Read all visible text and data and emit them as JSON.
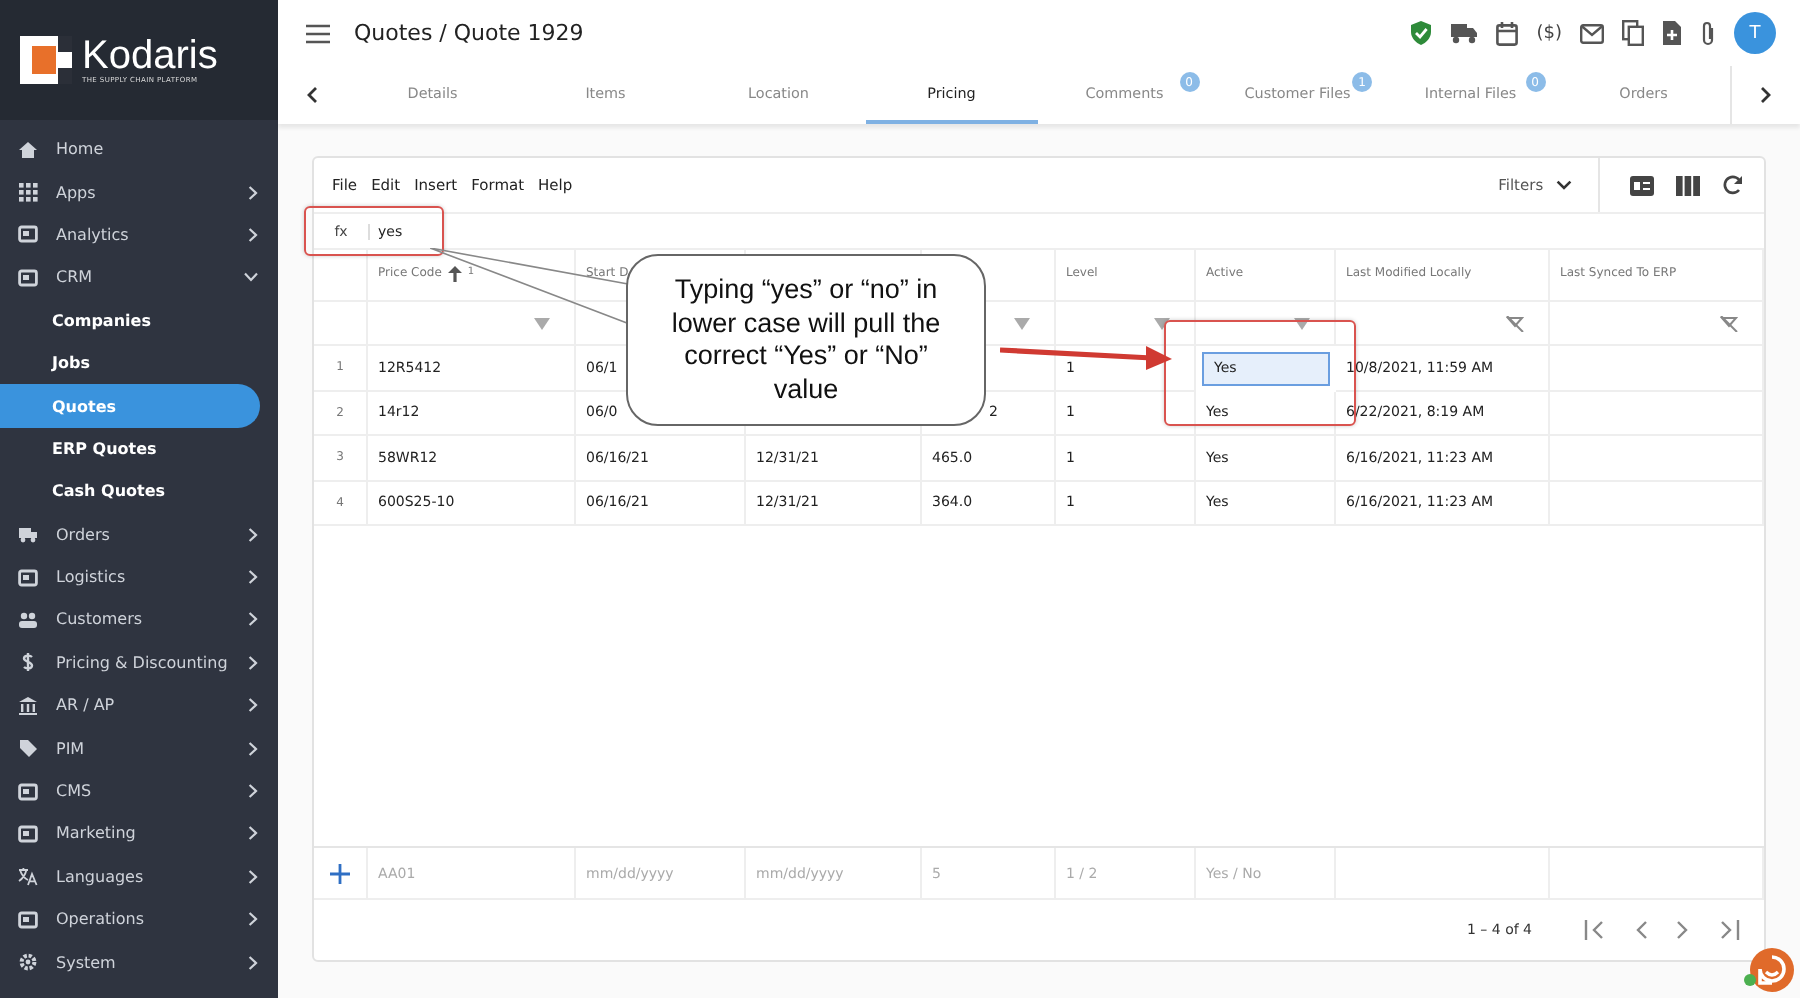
{
  "logo": {
    "name": "Kodaris",
    "tagline": "THE SUPPLY CHAIN PLATFORM"
  },
  "sidebar": {
    "items": [
      {
        "label": "Home",
        "selected": false
      },
      {
        "label": "Apps",
        "selected": false,
        "expanded": false
      },
      {
        "label": "Analytics",
        "selected": false,
        "expanded": false
      },
      {
        "label": "CRM",
        "selected": false,
        "expanded": true,
        "children": [
          {
            "label": "Companies",
            "selected": false
          },
          {
            "label": "Jobs",
            "selected": false
          },
          {
            "label": "Quotes",
            "selected": true
          },
          {
            "label": "ERP Quotes",
            "selected": false
          },
          {
            "label": "Cash Quotes",
            "selected": false
          }
        ]
      },
      {
        "label": "Orders",
        "selected": false,
        "expanded": false
      },
      {
        "label": "Logistics",
        "selected": false,
        "expanded": false
      },
      {
        "label": "Customers",
        "selected": false,
        "expanded": false
      },
      {
        "label": "Pricing & Discounting",
        "selected": false,
        "expanded": false
      },
      {
        "label": "AR / AP",
        "selected": false,
        "expanded": false
      },
      {
        "label": "PIM",
        "selected": false,
        "expanded": false
      },
      {
        "label": "CMS",
        "selected": false,
        "expanded": false
      },
      {
        "label": "Marketing",
        "selected": false,
        "expanded": false
      },
      {
        "label": "Languages",
        "selected": false,
        "expanded": false
      },
      {
        "label": "Operations",
        "selected": false,
        "expanded": false
      },
      {
        "label": "System",
        "selected": false,
        "expanded": false
      }
    ]
  },
  "header": {
    "title": "Quotes / Quote 1929",
    "dollar_icon": "($)",
    "avatar": "T"
  },
  "tabs": [
    {
      "label": "Details",
      "selected": false
    },
    {
      "label": "Items",
      "selected": false
    },
    {
      "label": "Location",
      "selected": false
    },
    {
      "label": "Pricing",
      "selected": true
    },
    {
      "label": "Comments",
      "selected": false,
      "badge": "0"
    },
    {
      "label": "Customer Files",
      "selected": false,
      "badge": "1"
    },
    {
      "label": "Internal Files",
      "selected": false,
      "badge": "0"
    },
    {
      "label": "Orders",
      "selected": false
    }
  ],
  "menu": [
    "File",
    "Edit",
    "Insert",
    "Format",
    "Help"
  ],
  "filters_label": "Filters",
  "formula_bar": {
    "label": "fx",
    "value": "yes"
  },
  "table": {
    "columns": [
      {
        "label": "Price Code",
        "sorted": true,
        "sort_index": "1",
        "kind": "filter"
      },
      {
        "label": "Start D",
        "kind": "plain"
      },
      {
        "kind": "plain"
      },
      {
        "kind": "filter"
      },
      {
        "label": "Level",
        "kind": "filter"
      },
      {
        "label": "Active",
        "kind": "filter"
      },
      {
        "label": "Last Modified Locally",
        "kind": "filter-off"
      },
      {
        "label": "Last Synced To ERP",
        "kind": "filter-off"
      }
    ],
    "rows": [
      {
        "number": "1",
        "cells": [
          {
            "text": "12R5412"
          },
          {
            "text": "06/1"
          },
          {},
          {},
          {
            "text": "1"
          },
          {
            "text": "Yes",
            "selected": true
          },
          {
            "text": "10/8/2021, 11:59 AM"
          },
          {}
        ]
      },
      {
        "number": "2",
        "cells": [
          {
            "text": "14r12"
          },
          {
            "text": "06/0"
          },
          {},
          {
            "text": "2",
            "partial": true
          },
          {
            "text": "1"
          },
          {
            "text": "Yes",
            "selected": false
          },
          {
            "text": "6/22/2021, 8:19 AM"
          },
          {}
        ]
      },
      {
        "number": "3",
        "cells": [
          {
            "text": "58WR12"
          },
          {
            "text": "06/16/21"
          },
          {
            "text": "12/31/21"
          },
          {
            "text": "465.0"
          },
          {
            "text": "1"
          },
          {
            "text": "Yes",
            "selected": false
          },
          {
            "text": "6/16/2021, 11:23 AM"
          },
          {}
        ]
      },
      {
        "number": "4",
        "cells": [
          {
            "text": "600S25-10"
          },
          {
            "text": "06/16/21"
          },
          {
            "text": "12/31/21"
          },
          {
            "text": "364.0"
          },
          {
            "text": "1"
          },
          {
            "text": "Yes",
            "selected": false
          },
          {
            "text": "6/16/2021, 11:23 AM"
          },
          {}
        ]
      }
    ],
    "new_row": [
      "AA01",
      "mm/dd/yyyy",
      "mm/dd/yyyy",
      "5",
      "1 / 2",
      "Yes / No"
    ]
  },
  "pagination": {
    "range": "1 – 4 of 4"
  },
  "callout": {
    "text": "Typing “yes” or “no” in lower case will pull the correct “Yes” or “No” value"
  }
}
